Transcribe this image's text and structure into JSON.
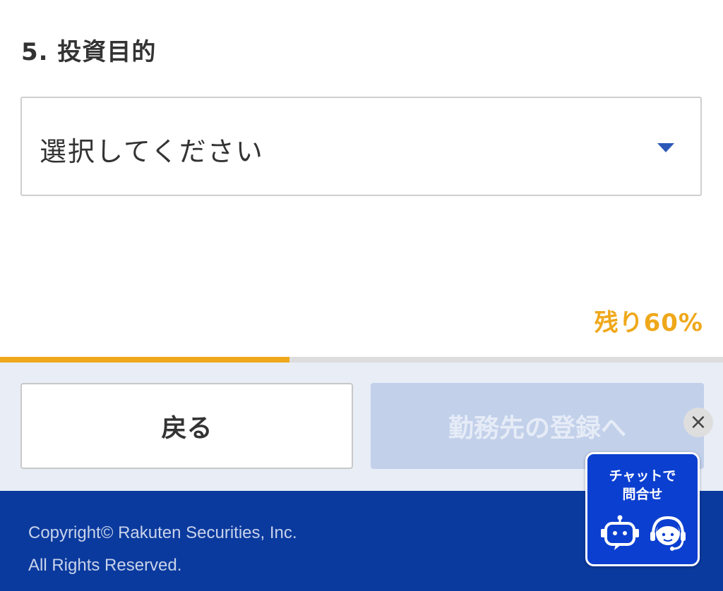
{
  "question": {
    "title": "5. 投資目的"
  },
  "select": {
    "placeholder": "選択してください",
    "icon": "chevron-down-icon"
  },
  "progress": {
    "label": "残り60%",
    "completed_fraction": 0.4,
    "color": "#efa81a"
  },
  "navigation": {
    "back_label": "戻る",
    "next_label": "勤務先の登録へ",
    "next_disabled": true
  },
  "footer": {
    "copyright_line1": "Copyright© Rakuten Securities, Inc.",
    "copyright_line2": "All Rights Reserved.",
    "background": "#0a3a9e"
  },
  "chat": {
    "close_icon": "close-icon",
    "label_line1": "チャットで",
    "label_line2": "問合せ",
    "icons": [
      "robot-icon",
      "operator-icon"
    ],
    "accent": "#0b3fd0"
  }
}
